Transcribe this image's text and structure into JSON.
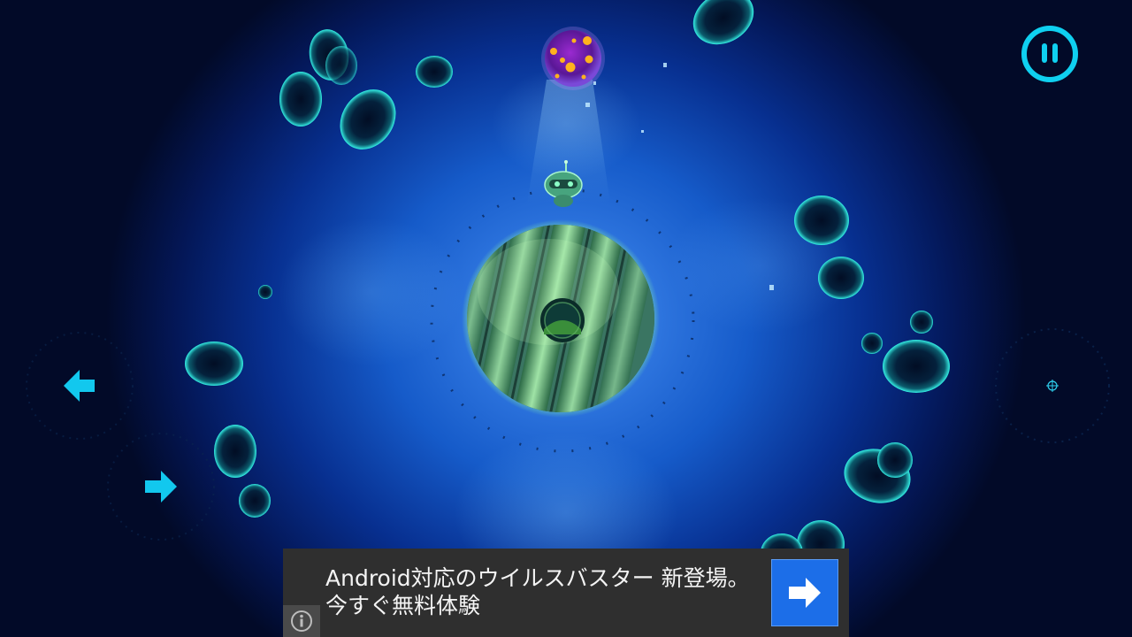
{
  "hud": {
    "pause_icon": "pause-icon",
    "move_left_icon": "arrow-left-icon",
    "move_right_icon": "arrow-right-icon",
    "accent_color": "#0fd0f0"
  },
  "scene": {
    "planet_color": "#6fb873",
    "hazard_orb_color": "#6a1ca8",
    "rock_outline_color": "#2ff3ea",
    "background_color": "#1a6ae0"
  },
  "ad": {
    "line1": "Android対応のウイルスバスター 新登場。",
    "line2": "今すぐ無料体験",
    "info_icon": "info-icon",
    "go_icon": "arrow-right-icon",
    "go_button_color": "#1c6ee8"
  }
}
